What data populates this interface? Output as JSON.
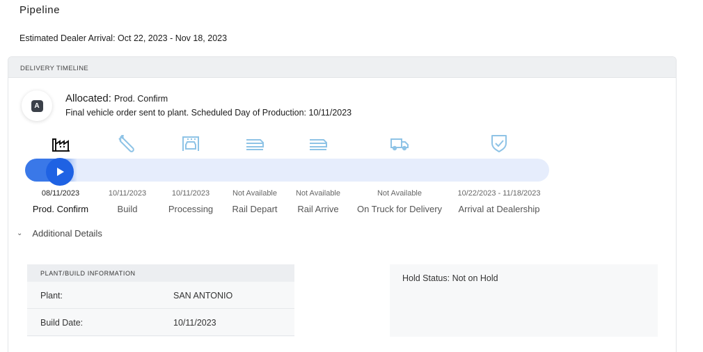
{
  "page": {
    "title": "Pipeline",
    "arrival": "Estimated Dealer Arrival: Oct 22, 2023 - Nov 18, 2023"
  },
  "timeline": {
    "header": "DELIVERY TIMELINE",
    "badge_letter": "A",
    "status_label": "Allocated:",
    "status_sub": "Prod. Confirm",
    "status_description": "Final vehicle order sent to plant. Scheduled Day of Production: 10/11/2023",
    "progress_fraction": 0.1,
    "colors": {
      "accent": "#1f62e3",
      "track": "#e6edfc",
      "inactive_icon": "#8ec3e6",
      "active_icon": "#111111"
    },
    "stages": [
      {
        "date": "08/11/2023",
        "name": "Prod. Confirm",
        "icon": "factory-icon",
        "active": true
      },
      {
        "date": "10/11/2023",
        "name": "Build",
        "icon": "wrench-icon",
        "active": false
      },
      {
        "date": "10/11/2023",
        "name": "Processing",
        "icon": "car-wash-icon",
        "active": false
      },
      {
        "date": "Not Available",
        "name": "Rail Depart",
        "icon": "rail-car-icon",
        "active": false
      },
      {
        "date": "Not Available",
        "name": "Rail Arrive",
        "icon": "rail-car-icon",
        "active": false
      },
      {
        "date": "Not Available",
        "name": "On Truck for Delivery",
        "icon": "truck-icon",
        "active": false
      },
      {
        "date": "10/22/2023 - 11/18/2023",
        "name": "Arrival at Dealership",
        "icon": "shield-check-icon",
        "active": false
      }
    ]
  },
  "details": {
    "toggle_label": "Additional Details",
    "plant_header": "PLANT/BUILD INFORMATION",
    "plant_label": "Plant:",
    "plant_value": "SAN ANTONIO",
    "build_date_label": "Build Date:",
    "build_date_value": "10/11/2023",
    "hold_status": "Hold Status: Not on Hold"
  }
}
